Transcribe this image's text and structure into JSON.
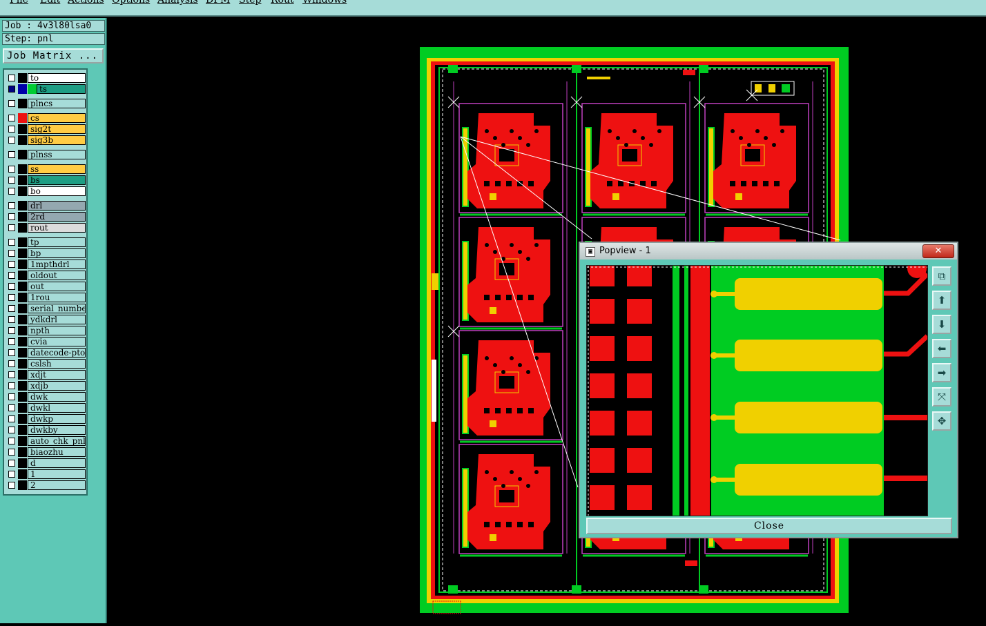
{
  "menu": [
    "File",
    "Edit",
    "Actions",
    "Options",
    "Analysis",
    "DFM",
    "Step",
    "Rout",
    "Windows"
  ],
  "job": {
    "job_label": "Job : 4v3l80lsa0",
    "step_label": "Step: pnl",
    "matrix_button": "Job Matrix ..."
  },
  "layers": [
    {
      "name": "to",
      "bg": "#ffffff",
      "swatch": "#000000",
      "active": false
    },
    {
      "name": "ts",
      "bg": "#1e9e84",
      "swatch": "#00cc33",
      "active": true
    },
    {
      "name": "plncs",
      "bg": "#a6dcd8",
      "swatch": "#000000",
      "active": false
    },
    {
      "name": "cs",
      "bg": "#ffcc44",
      "swatch": "#ee1111",
      "active": false
    },
    {
      "name": "sig2t",
      "bg": "#ffcc44",
      "swatch": "#000000",
      "active": false
    },
    {
      "name": "sig3b",
      "bg": "#ffcc44",
      "swatch": "#000000",
      "active": false
    },
    {
      "name": "plnss",
      "bg": "#a6dcd8",
      "swatch": "#000000",
      "active": false
    },
    {
      "name": "ss",
      "bg": "#ffcc44",
      "swatch": "#000000",
      "active": false
    },
    {
      "name": "bs",
      "bg": "#1e9e84",
      "swatch": "#000000",
      "active": false
    },
    {
      "name": "bo",
      "bg": "#ffffff",
      "swatch": "#000000",
      "active": false
    },
    {
      "name": "drl",
      "bg": "#94a8b0",
      "swatch": "#000000",
      "active": false
    },
    {
      "name": "2rd",
      "bg": "#94a8b0",
      "swatch": "#000000",
      "active": false
    },
    {
      "name": "rout",
      "bg": "#dcdcdc",
      "swatch": "#000000",
      "active": false
    },
    {
      "name": "tp",
      "bg": "#a6dcd8",
      "swatch": "#000000",
      "active": false
    },
    {
      "name": "bp",
      "bg": "#a6dcd8",
      "swatch": "#000000",
      "active": false
    },
    {
      "name": "1mpthdrl",
      "bg": "#a6dcd8",
      "swatch": "#000000",
      "active": false
    },
    {
      "name": "oldout",
      "bg": "#a6dcd8",
      "swatch": "#000000",
      "active": false
    },
    {
      "name": "out",
      "bg": "#a6dcd8",
      "swatch": "#000000",
      "active": false
    },
    {
      "name": "1rou",
      "bg": "#a6dcd8",
      "swatch": "#000000",
      "active": false
    },
    {
      "name": "serial_numbe",
      "bg": "#a6dcd8",
      "swatch": "#000000",
      "active": false
    },
    {
      "name": "ydkdrl",
      "bg": "#a6dcd8",
      "swatch": "#000000",
      "active": false
    },
    {
      "name": "npth",
      "bg": "#a6dcd8",
      "swatch": "#000000",
      "active": false
    },
    {
      "name": "cvia",
      "bg": "#a6dcd8",
      "swatch": "#000000",
      "active": false
    },
    {
      "name": "datecode-pto",
      "bg": "#a6dcd8",
      "swatch": "#000000",
      "active": false
    },
    {
      "name": "cslsh",
      "bg": "#a6dcd8",
      "swatch": "#000000",
      "active": false
    },
    {
      "name": "xdjt",
      "bg": "#a6dcd8",
      "swatch": "#000000",
      "active": false
    },
    {
      "name": "xdjb",
      "bg": "#a6dcd8",
      "swatch": "#000000",
      "active": false
    },
    {
      "name": "dwk",
      "bg": "#a6dcd8",
      "swatch": "#000000",
      "active": false
    },
    {
      "name": "dwkl",
      "bg": "#a6dcd8",
      "swatch": "#000000",
      "active": false
    },
    {
      "name": "dwkp",
      "bg": "#a6dcd8",
      "swatch": "#000000",
      "active": false
    },
    {
      "name": "dwkby",
      "bg": "#a6dcd8",
      "swatch": "#000000",
      "active": false
    },
    {
      "name": "auto_chk_pnl",
      "bg": "#a6dcd8",
      "swatch": "#000000",
      "active": false
    },
    {
      "name": "biaozhu",
      "bg": "#a6dcd8",
      "swatch": "#000000",
      "active": false
    },
    {
      "name": "d",
      "bg": "#a6dcd8",
      "swatch": "#000000",
      "active": false
    },
    {
      "name": "1",
      "bg": "#a6dcd8",
      "swatch": "#000000",
      "active": false
    },
    {
      "name": "2",
      "bg": "#a6dcd8",
      "swatch": "#000000",
      "active": false
    }
  ],
  "popview": {
    "title": "Popview - 1",
    "close_x": "✕",
    "close_label": "Close",
    "tools": [
      "zoom-window-icon",
      "pan-up-icon",
      "pan-down-icon",
      "pan-left-icon",
      "pan-right-icon",
      "zoom-in-icon",
      "zoom-out-icon"
    ]
  },
  "colors": {
    "ui_teal": "#5ec8b6",
    "ui_light": "#a6dcd8",
    "pcb_green": "#00cc22",
    "pcb_red": "#ee1111",
    "pcb_yellow": "#f0d000",
    "pcb_magenta": "#c040c0"
  }
}
